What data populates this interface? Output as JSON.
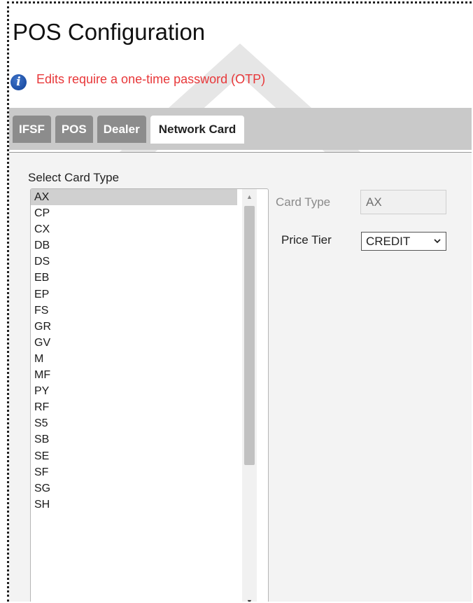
{
  "page": {
    "title": "POS Configuration",
    "notice": "Edits require a one-time password (OTP)"
  },
  "tabs": [
    {
      "label": "IFSF",
      "active": false
    },
    {
      "label": "POS",
      "active": false
    },
    {
      "label": "Dealer",
      "active": false
    },
    {
      "label": "Network Card",
      "active": true
    }
  ],
  "card_list": {
    "label": "Select Card Type",
    "selected": "AX",
    "items": [
      "AX",
      "CP",
      "CX",
      "DB",
      "DS",
      "EB",
      "EP",
      "FS",
      "GR",
      "GV",
      "M",
      "MF",
      "PY",
      "RF",
      "S5",
      "SB",
      "SE",
      "SF",
      "SG",
      "SH"
    ]
  },
  "form": {
    "card_type_label": "Card Type",
    "card_type_value": "AX",
    "price_tier_label": "Price Tier",
    "price_tier_value": "CREDIT"
  },
  "colors": {
    "notice_text": "#e8383a",
    "tab_inactive": "#8c8c8c",
    "tab_bar": "#c9c9c9",
    "info_icon": "#1a4fa8"
  },
  "icons": {
    "notice": "info-icon",
    "scroll_up": "scroll-up-arrow-icon",
    "scroll_down": "scroll-down-arrow-icon",
    "dropdown": "chevron-down-icon"
  }
}
